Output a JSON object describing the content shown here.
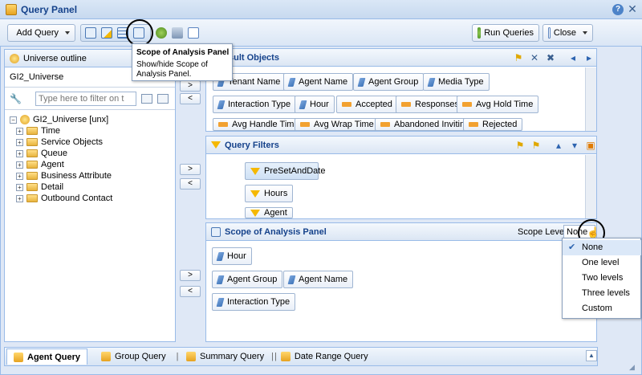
{
  "window": {
    "title": "Query Panel",
    "help_icon": "help-icon",
    "close_icon": "close-icon"
  },
  "toolbar": {
    "add_query_label": "Add Query",
    "run_queries_label": "Run Queries",
    "close_label": "Close"
  },
  "tooltip": {
    "title": "Scope of Analysis Panel",
    "body": "Show/hide Scope of Analysis Panel."
  },
  "universe_outline": {
    "header": "Universe outline",
    "universe_name": "GI2_Universe",
    "filter_placeholder": "Type here to filter on t",
    "root": "GI2_Universe [unx]",
    "items": [
      "Time",
      "Service Objects",
      "Queue",
      "Agent",
      "Business Attribute",
      "Detail",
      "Outbound Contact"
    ]
  },
  "result_objects": {
    "header": "sult Objects",
    "rows": [
      [
        "Tenant Name",
        "Agent Name",
        "Agent Group",
        "Media Type"
      ],
      [
        "Interaction Type",
        "Hour",
        "Accepted",
        "Responses",
        "Avg Hold Time"
      ],
      [
        "Avg Handle Time",
        "Avg Wrap Time",
        "Abandoned Inviting",
        "Rejected"
      ]
    ]
  },
  "query_filters": {
    "header": "Query Filters",
    "items": [
      "PreSetAndDate",
      "Hours",
      "Agent"
    ]
  },
  "scope_panel": {
    "header": "Scope of Analysis Panel",
    "scope_level_label": "Scope Level:",
    "scope_level_value": "None",
    "objects": [
      "Hour",
      "Agent Group",
      "Agent Name",
      "Interaction Type"
    ],
    "options": [
      "None",
      "One level",
      "Two levels",
      "Three levels",
      "Custom"
    ],
    "selected": "None"
  },
  "tabs": [
    "Agent Query",
    "Group Query",
    "Summary Query",
    "Date Range Query"
  ],
  "tab_separators": [
    "|",
    "|",
    "|"
  ],
  "arrows": {
    "right": ">",
    "left": "<"
  },
  "colors": {
    "accent": "#15428b",
    "border": "#99bbe8",
    "dimension": "#3e74b9",
    "measure": "#f2a130",
    "filter": "#f5b800"
  }
}
